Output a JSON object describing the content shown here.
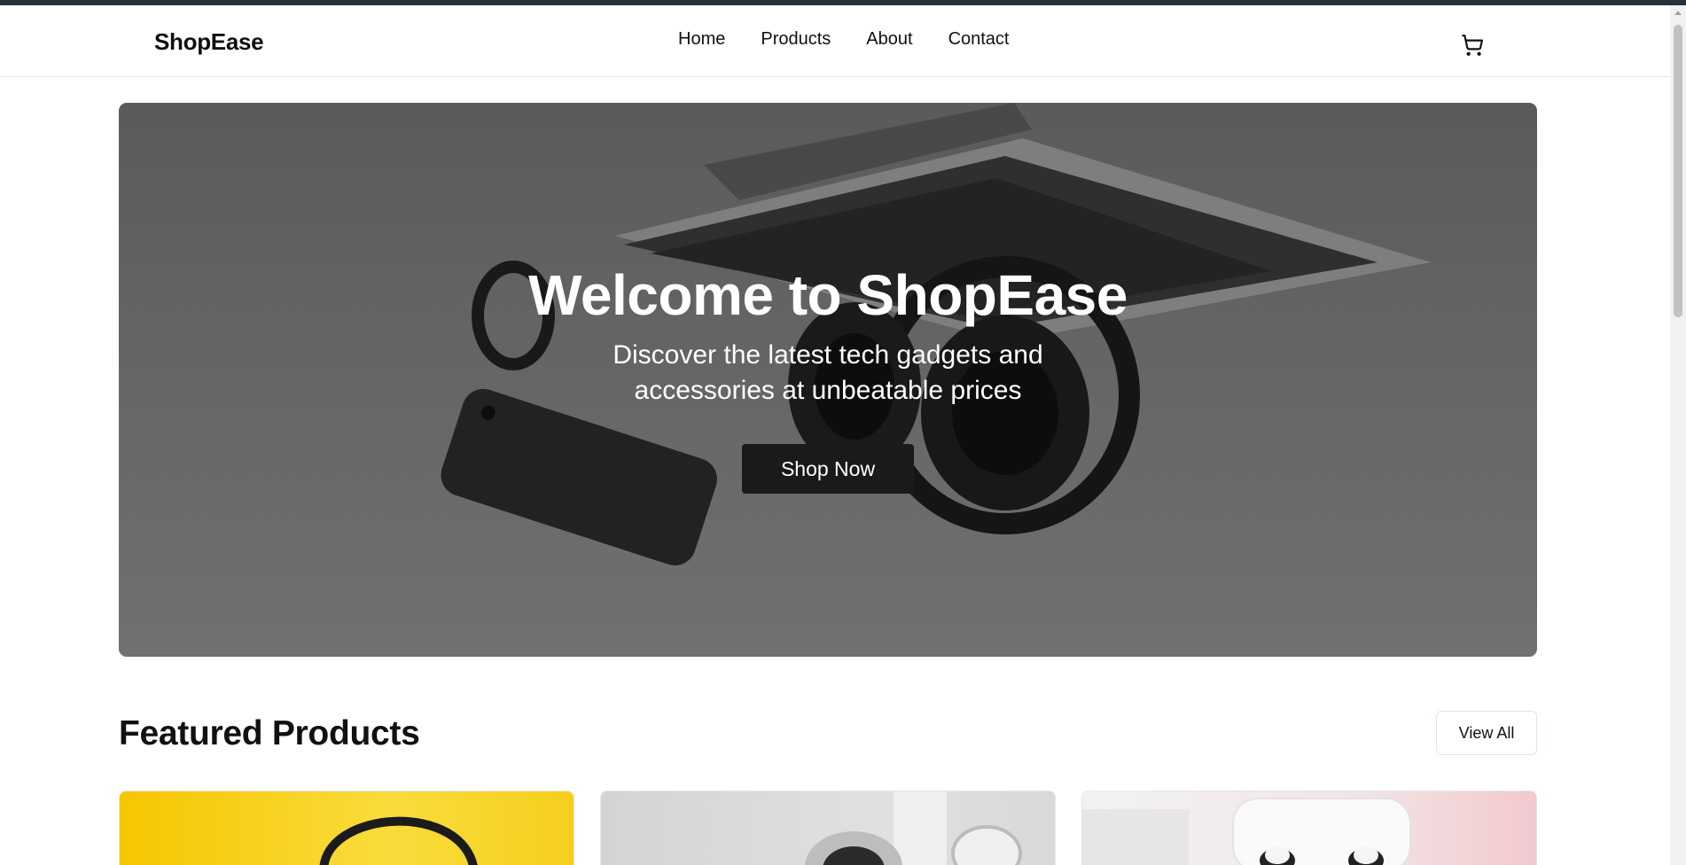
{
  "header": {
    "logo": "ShopEase",
    "nav": [
      "Home",
      "Products",
      "About",
      "Contact"
    ],
    "cart_icon": "cart-icon"
  },
  "hero": {
    "title": "Welcome to ShopEase",
    "subtitle": "Discover the latest tech gadgets and accessories at unbeatable prices",
    "button": "Shop Now"
  },
  "featured": {
    "title": "Featured Products",
    "view_all": "View All"
  },
  "colors": {
    "topstrip": "#26323b",
    "button_dark": "#1a1a1a",
    "card1": "#f6c600",
    "card2": "#d9d9db",
    "card3": "#f3c9cd"
  }
}
